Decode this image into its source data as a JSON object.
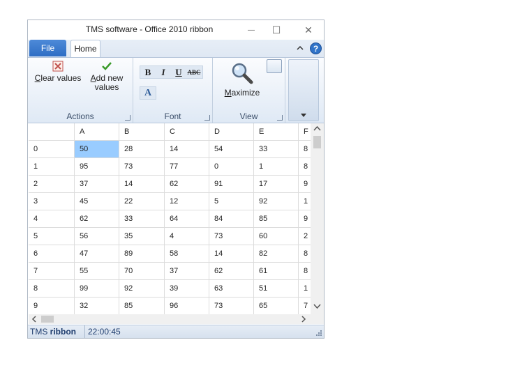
{
  "window": {
    "title": "TMS software - Office 2010 ribbon",
    "minimize_glyph": "—",
    "maximize_glyph": "☐",
    "close_glyph": "✕"
  },
  "tabs": {
    "file": "File",
    "home": "Home"
  },
  "ribbon": {
    "actions": {
      "label": "Actions",
      "clear_first": "C",
      "clear_rest": "lear values",
      "add_first": "A",
      "add_rest": "dd new",
      "add_line2": "values"
    },
    "font": {
      "label": "Font",
      "bold": "B",
      "italic": "I",
      "underline": "U",
      "strike": "ABC",
      "color": "A"
    },
    "view": {
      "label": "View",
      "maximize_first": "M",
      "maximize_rest": "aximize"
    }
  },
  "grid": {
    "columns": [
      "",
      "A",
      "B",
      "C",
      "D",
      "E",
      "F"
    ],
    "rows": [
      [
        "0",
        "50",
        "28",
        "14",
        "54",
        "33",
        "8"
      ],
      [
        "1",
        "95",
        "73",
        "77",
        "0",
        "1",
        "8"
      ],
      [
        "2",
        "37",
        "14",
        "62",
        "91",
        "17",
        "9"
      ],
      [
        "3",
        "45",
        "22",
        "12",
        "5",
        "92",
        "1"
      ],
      [
        "4",
        "62",
        "33",
        "64",
        "84",
        "85",
        "9"
      ],
      [
        "5",
        "56",
        "35",
        "4",
        "73",
        "60",
        "2"
      ],
      [
        "6",
        "47",
        "89",
        "58",
        "14",
        "82",
        "8"
      ],
      [
        "7",
        "55",
        "70",
        "37",
        "62",
        "61",
        "8"
      ],
      [
        "8",
        "99",
        "92",
        "39",
        "63",
        "51",
        "1"
      ],
      [
        "9",
        "32",
        "85",
        "96",
        "73",
        "65",
        "7"
      ]
    ]
  },
  "status": {
    "brand_prefix": "TMS ",
    "brand_bold": "ribbon",
    "time": "22:00:45"
  },
  "colors": {
    "accent": "#2e6dc4",
    "selection": "#99ccff",
    "help": "#2f73c8"
  }
}
